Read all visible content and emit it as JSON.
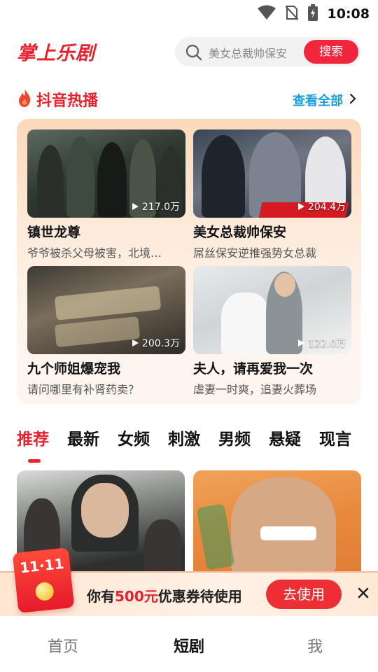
{
  "status_bar": {
    "time": "10:08",
    "icons": [
      "wifi-icon",
      "no-sim-icon",
      "battery-charging-icon"
    ]
  },
  "header": {
    "logo": "掌上乐剧",
    "search": {
      "placeholder": "美女总裁帅保安",
      "button": "搜索"
    }
  },
  "hot_section": {
    "title": "抖音热播",
    "more": "查看全部",
    "items": [
      {
        "name": "镇世龙尊",
        "desc": "爷爷被杀父母被害，北境…",
        "views": "217.0万"
      },
      {
        "name": "美女总裁帅保安",
        "desc": "屌丝保安逆推强势女总裁",
        "views": "204.4万"
      },
      {
        "name": "九个师姐爆宠我",
        "desc": "请问哪里有补肾药卖？",
        "views": "200.3万"
      },
      {
        "name": "夫人，请再爱我一次",
        "desc": "虐妻一时爽，追妻火葬场",
        "views": "122.0万"
      }
    ]
  },
  "category_tabs": [
    "推荐",
    "最新",
    "女频",
    "刺激",
    "男频",
    "悬疑",
    "现言"
  ],
  "active_tab": "推荐",
  "coupon": {
    "badge": "11·11",
    "text_prefix": "你有",
    "amount": "500元",
    "text_suffix": "优惠券待使用",
    "button": "去使用"
  },
  "bottom_nav": {
    "items": [
      "首页",
      "短剧",
      "我"
    ],
    "active": "短剧"
  },
  "colors": {
    "brand_red": "#e8222e",
    "link_blue": "#1aa0d8"
  }
}
